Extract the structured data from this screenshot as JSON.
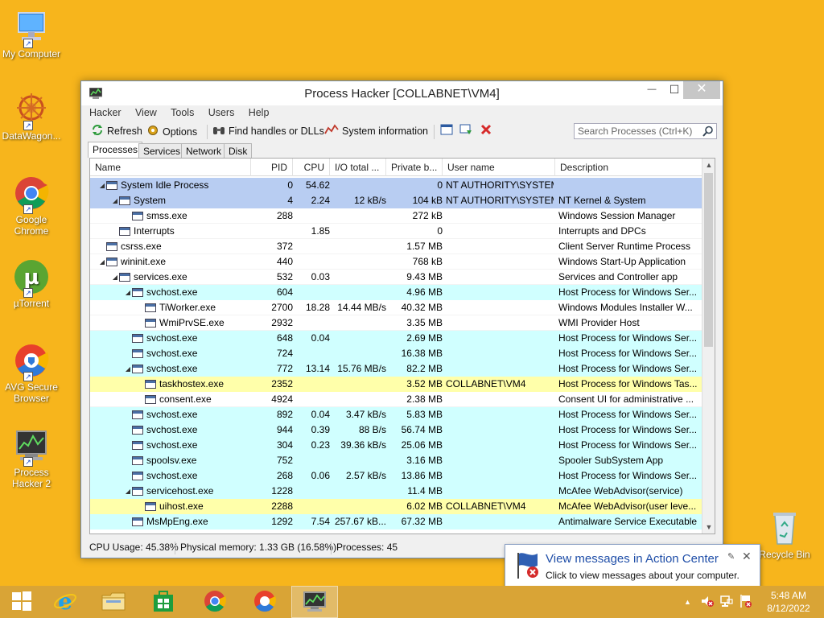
{
  "desktop": {
    "icons": [
      {
        "label": "My Computer"
      },
      {
        "label": "DataWagon..."
      },
      {
        "label": "Google Chrome"
      },
      {
        "label": "µTorrent"
      },
      {
        "label": "AVG Secure Browser"
      },
      {
        "label": "Process Hacker 2"
      },
      {
        "label": "Recycle Bin"
      }
    ]
  },
  "window": {
    "title": "Process Hacker [COLLABNET\\VM4]",
    "buttons": {
      "minimize": "—",
      "maximize": "☐",
      "close": "✕"
    },
    "menu": [
      "Hacker",
      "View",
      "Tools",
      "Users",
      "Help"
    ],
    "toolbar": {
      "refresh": "Refresh",
      "options": "Options",
      "find_handles": "Find handles or DLLs",
      "system_information": "System information",
      "search_placeholder": "Search Processes (Ctrl+K)"
    },
    "tabs": [
      "Processes",
      "Services",
      "Network",
      "Disk"
    ],
    "columns": [
      "Name",
      "PID",
      "CPU",
      "I/O total ...",
      "Private b...",
      "User name",
      "Description"
    ],
    "processes": [
      {
        "name": "System Idle Process",
        "pid": "0",
        "cpu": "54.62",
        "io": "",
        "priv": "0",
        "user": "NT AUTHORITY\\SYSTEM",
        "desc": "",
        "depth": 0,
        "expander": "◢",
        "bg": "#b8cdf2"
      },
      {
        "name": "System",
        "pid": "4",
        "cpu": "2.24",
        "io": "12 kB/s",
        "priv": "104 kB",
        "user": "NT AUTHORITY\\SYSTEM",
        "desc": "NT Kernel & System",
        "depth": 1,
        "expander": "◢",
        "bg": "#b8cdf2"
      },
      {
        "name": "smss.exe",
        "pid": "288",
        "cpu": "",
        "io": "",
        "priv": "272 kB",
        "user": "",
        "desc": "Windows Session Manager",
        "depth": 2,
        "expander": "",
        "bg": "#ffffff"
      },
      {
        "name": "Interrupts",
        "pid": "",
        "cpu": "1.85",
        "io": "",
        "priv": "0",
        "user": "",
        "desc": "Interrupts and DPCs",
        "depth": 1,
        "expander": "",
        "bg": "#ffffff"
      },
      {
        "name": "csrss.exe",
        "pid": "372",
        "cpu": "",
        "io": "",
        "priv": "1.57 MB",
        "user": "",
        "desc": "Client Server Runtime Process",
        "depth": 0,
        "expander": "",
        "bg": "#ffffff"
      },
      {
        "name": "wininit.exe",
        "pid": "440",
        "cpu": "",
        "io": "",
        "priv": "768 kB",
        "user": "",
        "desc": "Windows Start-Up Application",
        "depth": 0,
        "expander": "◢",
        "bg": "#ffffff"
      },
      {
        "name": "services.exe",
        "pid": "532",
        "cpu": "0.03",
        "io": "",
        "priv": "9.43 MB",
        "user": "",
        "desc": "Services and Controller app",
        "depth": 1,
        "expander": "◢",
        "bg": "#ffffff"
      },
      {
        "name": "svchost.exe",
        "pid": "604",
        "cpu": "",
        "io": "",
        "priv": "4.96 MB",
        "user": "",
        "desc": "Host Process for Windows Ser...",
        "depth": 2,
        "expander": "◢",
        "bg": "#d0ffff"
      },
      {
        "name": "TiWorker.exe",
        "pid": "2700",
        "cpu": "18.28",
        "io": "14.44 MB/s",
        "priv": "40.32 MB",
        "user": "",
        "desc": "Windows Modules Installer W...",
        "depth": 3,
        "expander": "",
        "bg": "#ffffff"
      },
      {
        "name": "WmiPrvSE.exe",
        "pid": "2932",
        "cpu": "",
        "io": "",
        "priv": "3.35 MB",
        "user": "",
        "desc": "WMI Provider Host",
        "depth": 3,
        "expander": "",
        "bg": "#ffffff"
      },
      {
        "name": "svchost.exe",
        "pid": "648",
        "cpu": "0.04",
        "io": "",
        "priv": "2.69 MB",
        "user": "",
        "desc": "Host Process for Windows Ser...",
        "depth": 2,
        "expander": "",
        "bg": "#d0ffff"
      },
      {
        "name": "svchost.exe",
        "pid": "724",
        "cpu": "",
        "io": "",
        "priv": "16.38 MB",
        "user": "",
        "desc": "Host Process for Windows Ser...",
        "depth": 2,
        "expander": "",
        "bg": "#d0ffff"
      },
      {
        "name": "svchost.exe",
        "pid": "772",
        "cpu": "13.14",
        "io": "15.76 MB/s",
        "priv": "82.2 MB",
        "user": "",
        "desc": "Host Process for Windows Ser...",
        "depth": 2,
        "expander": "◢",
        "bg": "#d0ffff"
      },
      {
        "name": "taskhostex.exe",
        "pid": "2352",
        "cpu": "",
        "io": "",
        "priv": "3.52 MB",
        "user": "COLLABNET\\VM4",
        "desc": "Host Process for Windows Tas...",
        "depth": 3,
        "expander": "",
        "bg": "#ffffaa"
      },
      {
        "name": "consent.exe",
        "pid": "4924",
        "cpu": "",
        "io": "",
        "priv": "2.38 MB",
        "user": "",
        "desc": "Consent UI for administrative ...",
        "depth": 3,
        "expander": "",
        "bg": "#ffffff"
      },
      {
        "name": "svchost.exe",
        "pid": "892",
        "cpu": "0.04",
        "io": "3.47 kB/s",
        "priv": "5.83 MB",
        "user": "",
        "desc": "Host Process for Windows Ser...",
        "depth": 2,
        "expander": "",
        "bg": "#d0ffff"
      },
      {
        "name": "svchost.exe",
        "pid": "944",
        "cpu": "0.39",
        "io": "88 B/s",
        "priv": "56.74 MB",
        "user": "",
        "desc": "Host Process for Windows Ser...",
        "depth": 2,
        "expander": "",
        "bg": "#d0ffff"
      },
      {
        "name": "svchost.exe",
        "pid": "304",
        "cpu": "0.23",
        "io": "39.36 kB/s",
        "priv": "25.06 MB",
        "user": "",
        "desc": "Host Process for Windows Ser...",
        "depth": 2,
        "expander": "",
        "bg": "#d0ffff"
      },
      {
        "name": "spoolsv.exe",
        "pid": "752",
        "cpu": "",
        "io": "",
        "priv": "3.16 MB",
        "user": "",
        "desc": "Spooler SubSystem App",
        "depth": 2,
        "expander": "",
        "bg": "#d0ffff"
      },
      {
        "name": "svchost.exe",
        "pid": "268",
        "cpu": "0.06",
        "io": "2.57 kB/s",
        "priv": "13.86 MB",
        "user": "",
        "desc": "Host Process for Windows Ser...",
        "depth": 2,
        "expander": "",
        "bg": "#d0ffff"
      },
      {
        "name": "servicehost.exe",
        "pid": "1228",
        "cpu": "",
        "io": "",
        "priv": "11.4 MB",
        "user": "",
        "desc": "McAfee WebAdvisor(service)",
        "depth": 2,
        "expander": "◢",
        "bg": "#d0ffff"
      },
      {
        "name": "uihost.exe",
        "pid": "2288",
        "cpu": "",
        "io": "",
        "priv": "6.02 MB",
        "user": "COLLABNET\\VM4",
        "desc": "McAfee WebAdvisor(user leve...",
        "depth": 3,
        "expander": "",
        "bg": "#ffffaa"
      },
      {
        "name": "MsMpEng.exe",
        "pid": "1292",
        "cpu": "7.54",
        "io": "257.67 kB...",
        "priv": "67.32 MB",
        "user": "",
        "desc": "Antimalware Service Executable",
        "depth": 2,
        "expander": "",
        "bg": "#d0ffff"
      }
    ],
    "status": {
      "cpu": "CPU Usage: 45.38%",
      "memory": "Physical memory: 1.33 GB (16.58%)",
      "processes": "Processes: 45"
    }
  },
  "notification": {
    "title": "View messages in Action Center",
    "body": "Click to view messages about your computer."
  },
  "taskbar": {
    "time": "5:48 AM",
    "date": "8/12/2022"
  }
}
